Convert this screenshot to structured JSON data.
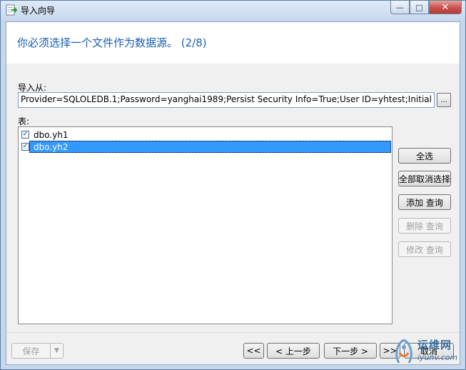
{
  "window": {
    "title": "导入向导",
    "minimize_glyph": "—",
    "maximize_glyph": "□",
    "close_glyph": "✕"
  },
  "header": {
    "heading": "你必须选择一个文件作为数据源。 (2/8)"
  },
  "source": {
    "label": "导入从:",
    "value": "Provider=SQLOLEDB.1;Password=yanghai1989;Persist Security Info=True;User ID=yhtest;Initial Catalog=",
    "browse_label": "..."
  },
  "tables": {
    "label": "表:",
    "items": [
      {
        "name": "dbo.yh1",
        "checked": true,
        "selected": false
      },
      {
        "name": "dbo.yh2",
        "checked": true,
        "selected": true
      }
    ],
    "check_glyph": "✓"
  },
  "side_buttons": {
    "select_all": "全选",
    "deselect_all": "全部取消选择",
    "add_query": "添加 查询",
    "delete_query": "删除 查询",
    "modify_query": "修改 查询"
  },
  "footer": {
    "save": "保存",
    "save_arrow": "▼",
    "first": "<<",
    "prev": "< 上一步",
    "next": "下一步 >",
    "last": ">>",
    "cancel": "取消"
  },
  "watermark": {
    "line1": "运维网",
    "line2": "iyunv.com"
  },
  "colors": {
    "heading": "#1a5fb4",
    "selection": "#3399ff",
    "close_button": "#c75050"
  }
}
